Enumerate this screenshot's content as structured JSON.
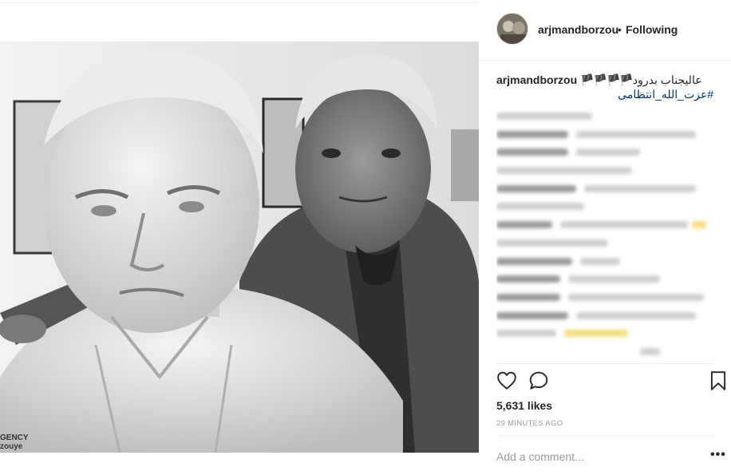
{
  "post": {
    "author": "arjmandborzou",
    "follow_state": "Following",
    "separator": "•",
    "caption": {
      "user": "arjmandborzou",
      "text": "عالیجناب بدرود",
      "flags": "🏴🏴🏴🏴",
      "hashtag": "#عزت_الله_انتظامی"
    },
    "likes": "5,631 likes",
    "time_ago": "29 MINUTES AGO",
    "add_comment_placeholder": "Add a comment...",
    "more_glyph": "•••",
    "photo_watermark_line1": "GENCY",
    "photo_watermark_line2": "zouye"
  },
  "icons": {
    "like": "heart-icon",
    "comment": "comment-icon",
    "save": "bookmark-icon",
    "more": "more-options-icon"
  },
  "colors": {
    "hashtag": "#003569",
    "text": "#262626",
    "muted": "#999999",
    "divider": "#efefef"
  }
}
